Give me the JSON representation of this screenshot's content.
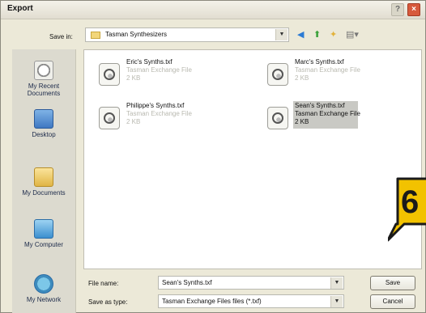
{
  "dialog": {
    "title": "Export"
  },
  "save_in": {
    "label": "Save in:",
    "value": "Tasman Synthesizers"
  },
  "nav_icons": [
    "back-icon",
    "up-folder-icon",
    "new-folder-icon",
    "view-menu-icon"
  ],
  "places": [
    {
      "label": "My Recent Documents",
      "icon": "recent-documents-icon"
    },
    {
      "label": "Desktop",
      "icon": "desktop-icon"
    },
    {
      "label": "My Documents",
      "icon": "my-documents-icon"
    },
    {
      "label": "My Computer",
      "icon": "my-computer-icon"
    },
    {
      "label": "My Network",
      "icon": "my-network-icon"
    }
  ],
  "files": [
    {
      "name": "Eric's Synths.txf",
      "type": "Tasman Exchange File",
      "size": "2 KB",
      "selected": false
    },
    {
      "name": "Marc's Synths.txf",
      "type": "Tasman Exchange File",
      "size": "2 KB",
      "selected": false
    },
    {
      "name": "Philippe's Synths.txf",
      "type": "Tasman Exchange File",
      "size": "2 KB",
      "selected": false
    },
    {
      "name": "Sean's Synths.txf",
      "type": "Tasman Exchange File",
      "size": "2 KB",
      "selected": true
    }
  ],
  "badge": {
    "text": "6"
  },
  "file_name": {
    "label": "File name:",
    "value": "Sean's Synths.txf"
  },
  "save_as_type": {
    "label": "Save as type:",
    "value": "Tasman Exchange Files files (*.txf)"
  },
  "buttons": {
    "save": "Save",
    "cancel": "Cancel"
  },
  "colors": {
    "badge_fill": "#f2c200",
    "badge_stroke": "#1a1a1a",
    "close_button": "#d75a3c",
    "selection": "#c9c9c4"
  }
}
